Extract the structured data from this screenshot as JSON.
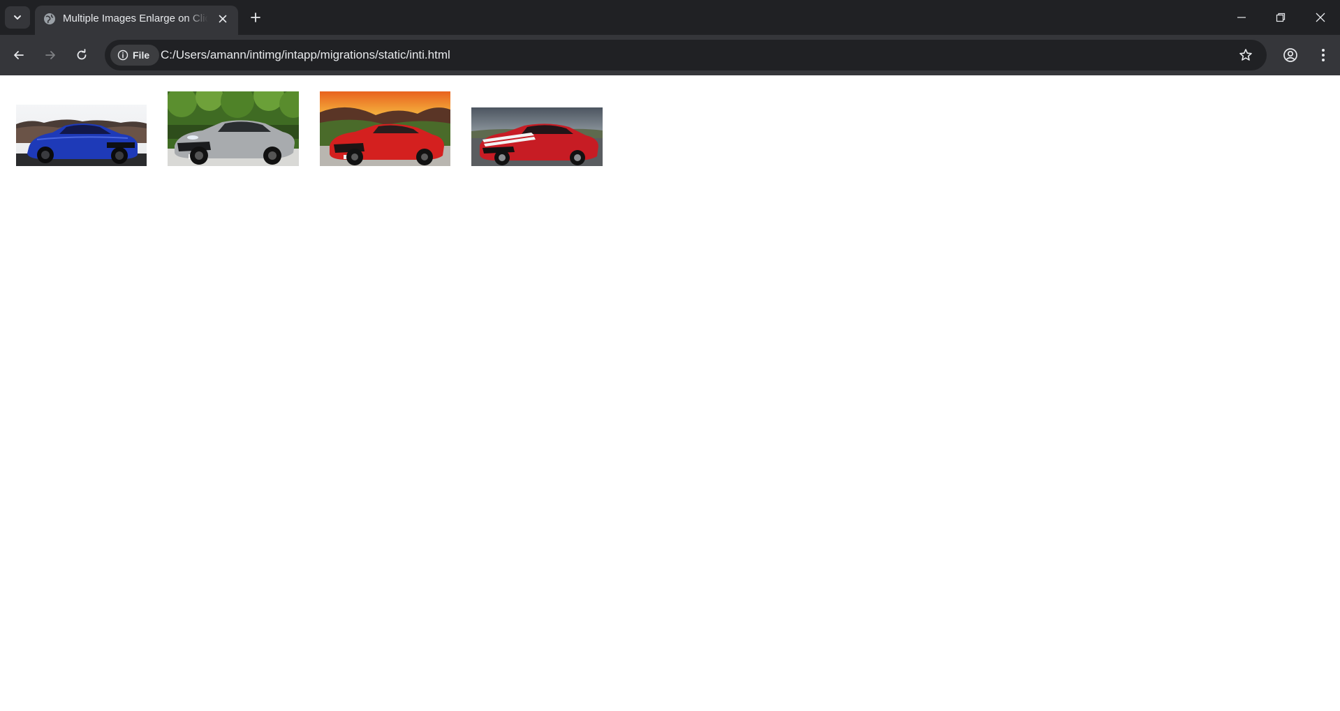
{
  "browser": {
    "tab": {
      "title": "Multiple Images Enlarge on Click",
      "favicon": "globe-icon"
    },
    "address_bar": {
      "chip_label": "File",
      "url": "C:/Users/amann/intimg/intapp/migrations/static/inti.html"
    },
    "icons": {
      "tab_search": "chevron-down-icon",
      "tab_close": "close-icon",
      "new_tab": "plus-icon",
      "minimize": "minimize-icon",
      "restore": "restore-icon",
      "close_window": "close-icon",
      "back": "arrow-left-icon",
      "forward": "arrow-right-icon",
      "reload": "reload-icon",
      "site_info": "info-icon",
      "bookmark": "star-icon",
      "profile": "profile-icon",
      "menu": "kebab-menu-icon"
    },
    "colors": {
      "frame": "#202124",
      "toolbar": "#35363a",
      "omnibox": "#202124",
      "text": "#e8eaed"
    }
  },
  "page": {
    "background": "#ffffff",
    "images": [
      {
        "subject": "blue sedan",
        "body_color": "#1f3db8"
      },
      {
        "subject": "silver sports car",
        "body_color": "#a9acaf"
      },
      {
        "subject": "red roadster",
        "body_color": "#d21f1f"
      },
      {
        "subject": "red muscle car with white stripes",
        "body_color": "#c81d25"
      }
    ]
  }
}
